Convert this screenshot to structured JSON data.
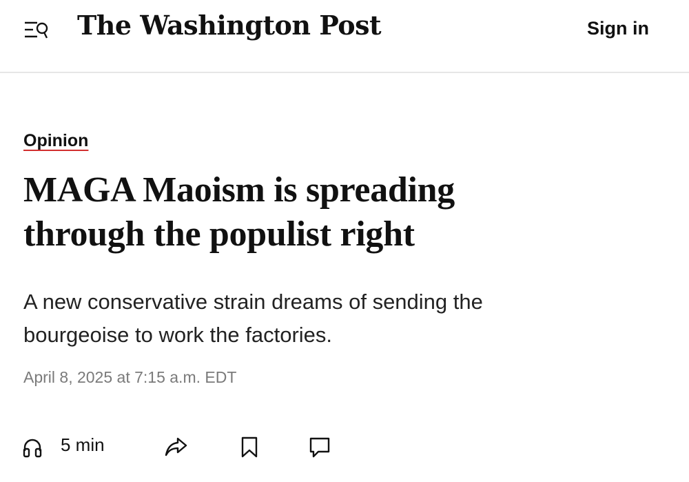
{
  "header": {
    "logo_text": "The Washington Post",
    "sign_in_label": "Sign in",
    "menu_icon": "menu-search-icon"
  },
  "article": {
    "section": "Opinion",
    "headline_line1": "MAGA Maoism is spreading",
    "headline_line2": "through the populist right",
    "dek_line1": "A new conservative strain dreams of sending the",
    "dek_line2": "bourgeoise to work the factories.",
    "timestamp": "April 8, 2025 at 7:15 a.m. EDT"
  },
  "actions": {
    "listen_label": "5 min",
    "listen_icon": "headphones-icon",
    "share_icon": "share-icon",
    "save_icon": "bookmark-icon",
    "comment_icon": "comment-icon"
  },
  "colors": {
    "text": "#111111",
    "muted": "#7a7a7a",
    "underline_accent": "#d22f2f",
    "divider": "#e6e6e6"
  }
}
